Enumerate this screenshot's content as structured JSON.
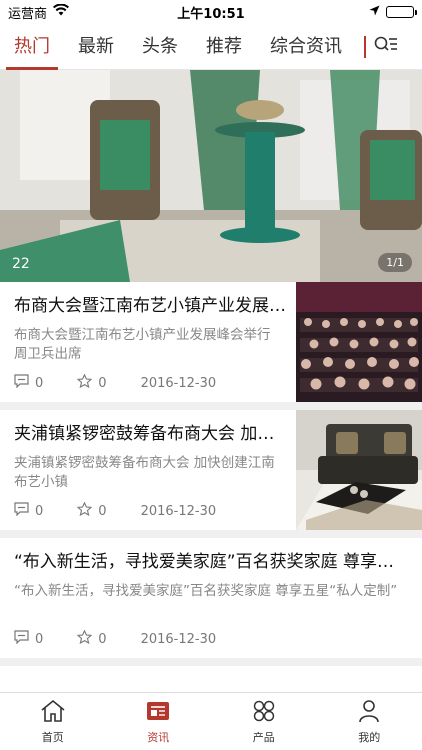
{
  "status": {
    "carrier": "运营商",
    "time": "上午10:51"
  },
  "tabs": [
    {
      "label": "热门",
      "active": true
    },
    {
      "label": "最新",
      "active": false
    },
    {
      "label": "头条",
      "active": false
    },
    {
      "label": "推荐",
      "active": false
    },
    {
      "label": "综合资讯",
      "active": false
    }
  ],
  "banner": {
    "count": "22",
    "pager": "1/1"
  },
  "news": [
    {
      "title": "布商大会暨江南布艺小镇产业发展峰会举行 周卫兵出席",
      "desc": "布商大会暨江南布艺小镇产业发展峰会举行 周卫兵出席",
      "comments": "0",
      "likes": "0",
      "date": "2016-12-30"
    },
    {
      "title": "夹浦镇紧锣密鼓筹备布商大会 加快创建江南布艺小镇",
      "desc": "夹浦镇紧锣密鼓筹备布商大会 加快创建江南布艺小镇",
      "comments": "0",
      "likes": "0",
      "date": "2016-12-30"
    },
    {
      "title": "“布入新生活，寻找爱美家庭”百名获奖家庭 尊享五星“私人定制”",
      "desc": "“布入新生活，寻找爱美家庭”百名获奖家庭 尊享五星“私人定制”",
      "comments": "0",
      "likes": "0",
      "date": "2016-12-30"
    }
  ],
  "bottom_nav": [
    {
      "label": "首页",
      "icon": "home-icon",
      "active": false
    },
    {
      "label": "资讯",
      "icon": "news-icon",
      "active": true
    },
    {
      "label": "产品",
      "icon": "grid-icon",
      "active": false
    },
    {
      "label": "我的",
      "icon": "user-icon",
      "active": false
    }
  ],
  "colors": {
    "accent": "#b5382f"
  }
}
